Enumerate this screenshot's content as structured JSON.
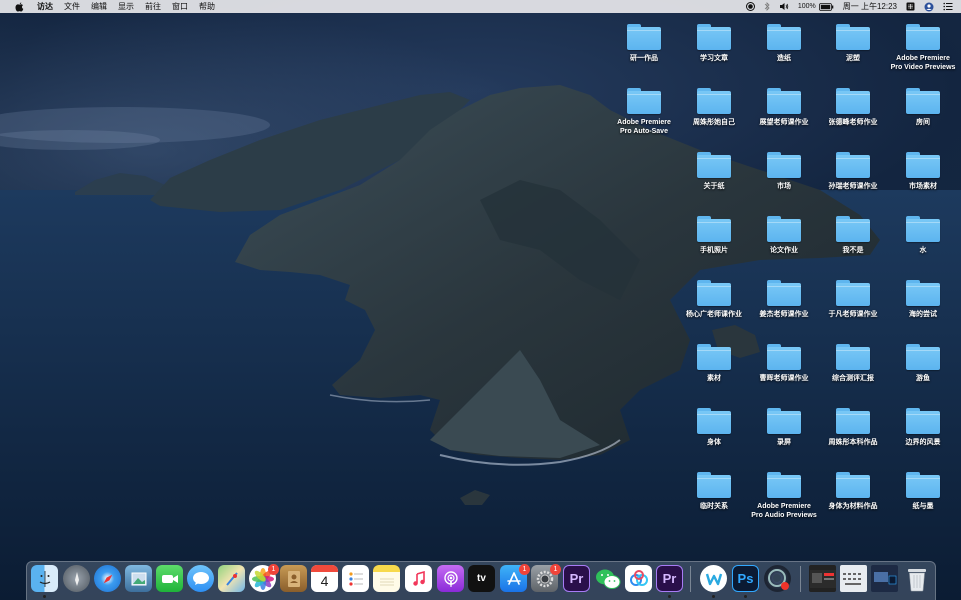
{
  "menubar": {
    "items": [
      "访达",
      "文件",
      "编辑",
      "显示",
      "前往",
      "窗口",
      "帮助"
    ],
    "battery": "100%",
    "clock": "周一 上午12:23"
  },
  "desktop": {
    "icons": [
      "研一作品",
      "学习文章",
      "造纸",
      "泥塑",
      "Adobe Premiere\nPro Video Previews",
      "Adobe Premiere\nPro Auto-Save",
      "周姝彤她自己",
      "展望老师课作业",
      "张德峰老师作业",
      "房间",
      "关于纸",
      "市场",
      "孙瑞老师课作业",
      "市场素材",
      "手机照片",
      "论文作业",
      "我不是",
      "水",
      "杨心广老师课作业",
      "姜杰老师课作业",
      "于凡老师课作业",
      "海的尝试",
      "素材",
      "曹晖老师课作业",
      "综合测评汇报",
      "游鱼",
      "身体",
      "录屏",
      "周姝彤本科作品",
      "边界的风景",
      "临时关系",
      "Adobe Premiere\nPro Audio Previews",
      "身体为材料作品",
      "纸与墨"
    ]
  },
  "dock": {
    "tv_label": "tv",
    "calendar_day": "4",
    "ps_label": "Ps",
    "pr_label": "Pr",
    "badges": {
      "photos": "1",
      "appstore": "1",
      "preferences": "1"
    }
  }
}
